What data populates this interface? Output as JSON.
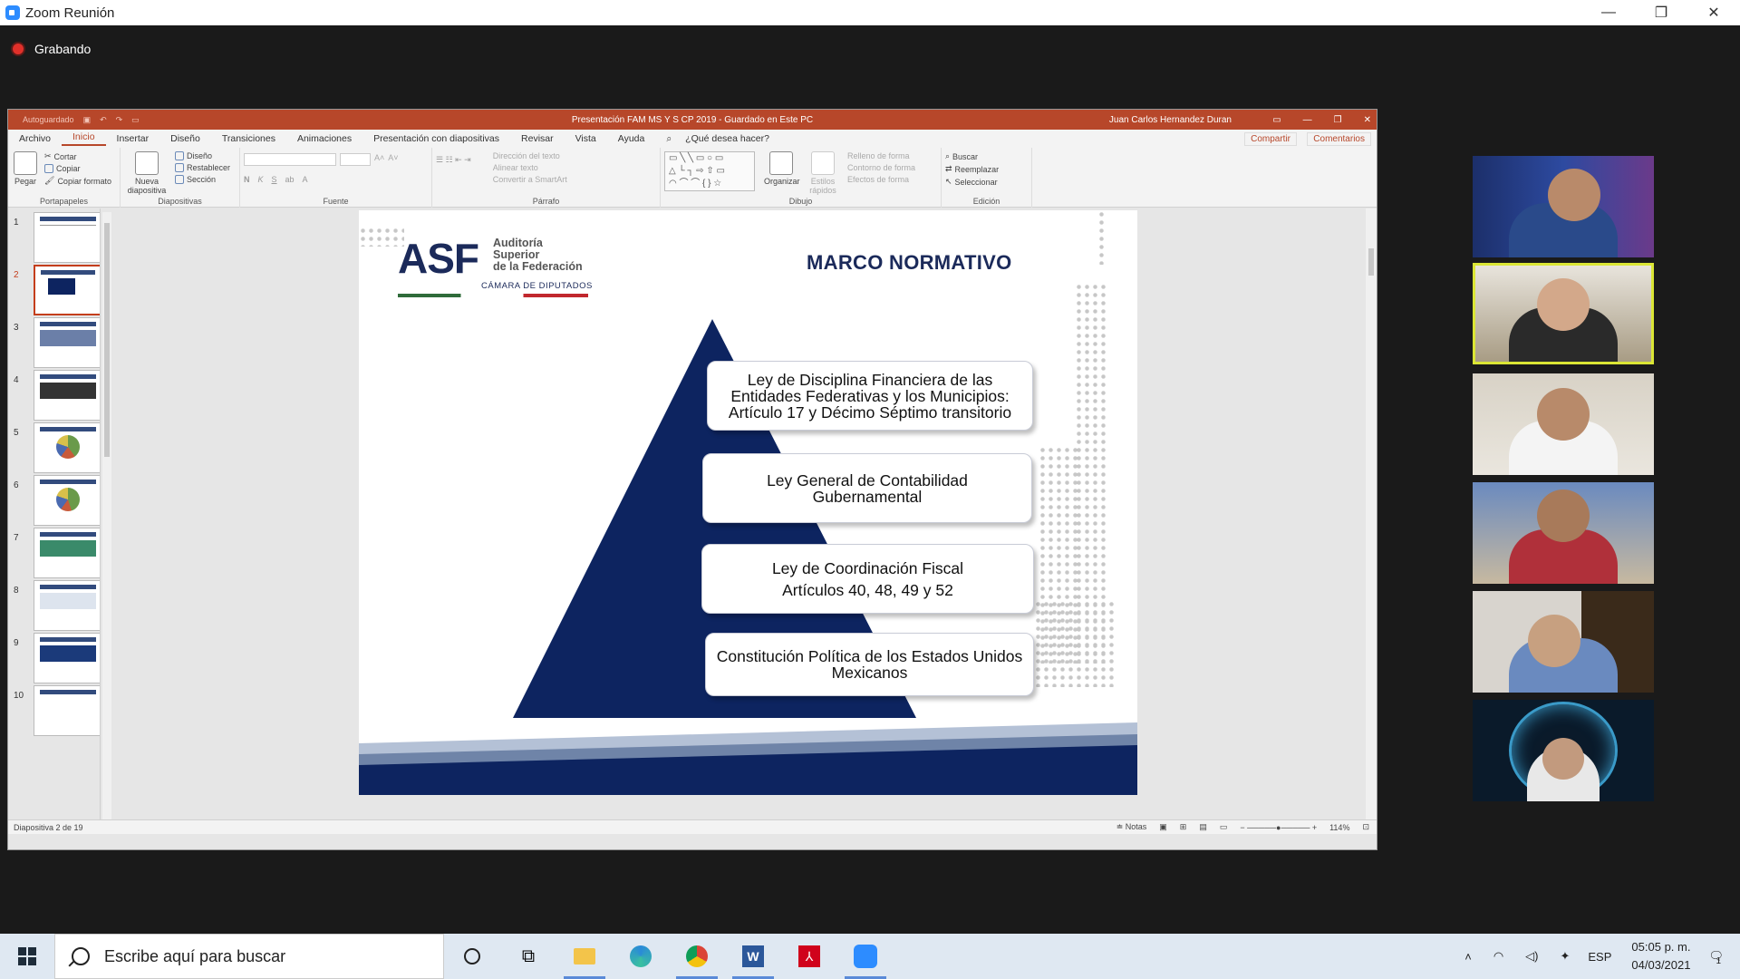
{
  "zoom": {
    "window_title": "Zoom Reunión",
    "recording_label": "Grabando",
    "controls": {
      "minimize": "—",
      "restore": "❐",
      "close": "✕"
    }
  },
  "powerpoint": {
    "title": "Presentación FAM MS Y S CP 2019 - Guardado en Este PC",
    "autosave": "Autoguardado",
    "user": "Juan Carlos Hernandez Duran",
    "tabs": [
      "Archivo",
      "Inicio",
      "Insertar",
      "Diseño",
      "Transiciones",
      "Animaciones",
      "Presentación con diapositivas",
      "Revisar",
      "Vista",
      "Ayuda"
    ],
    "active_tab": "Inicio",
    "tell_me": "¿Qué desea hacer?",
    "share": "Compartir",
    "comments": "Comentarios",
    "ribbon": {
      "portapapeles": {
        "label": "Portapapeles",
        "paste": "Pegar",
        "cut": "Cortar",
        "copy": "Copiar",
        "format": "Copiar formato"
      },
      "diapositivas": {
        "label": "Diapositivas",
        "new": "Nueva diapositiva",
        "layout": "Diseño",
        "reset": "Restablecer",
        "section": "Sección"
      },
      "fuente": {
        "label": "Fuente"
      },
      "parrafo": {
        "label": "Párrafo",
        "dir": "Dirección del texto",
        "align": "Alinear texto",
        "smartart": "Convertir a SmartArt"
      },
      "dibujo": {
        "label": "Dibujo",
        "arrange": "Organizar",
        "styles": "Estilos rápidos",
        "fill": "Relleno de forma",
        "outline": "Contorno de forma",
        "effects": "Efectos de forma"
      },
      "edicion": {
        "label": "Edición",
        "find": "Buscar",
        "replace": "Reemplazar",
        "select": "Seleccionar"
      }
    },
    "status": {
      "slide": "Diapositiva 2 de 19",
      "notes": "Notas",
      "zoom": "114%"
    },
    "thumbnails": [
      1,
      2,
      3,
      4,
      5,
      6,
      7,
      8,
      9,
      10
    ],
    "selected_slide": 2
  },
  "slide": {
    "logo_text": "ASF",
    "logo_sub1": "Auditoría",
    "logo_sub2": "Superior",
    "logo_sub3": "de la Federación",
    "logo_camara": "CÁMARA DE DIPUTADOS",
    "title": "MARCO NORMATIVO",
    "boxes": [
      {
        "line1": "Ley de Disciplina Financiera de las",
        "line2": "Entidades Federativas y los Municipios:",
        "line3": "Artículo 17 y Décimo Séptimo transitorio"
      },
      {
        "line1": "Ley General de Contabilidad",
        "line2": "Gubernamental"
      },
      {
        "line1": "Ley de Coordinación Fiscal",
        "line2": "Artículos 40, 48, 49 y 52"
      },
      {
        "line1": "Constitución Política de los Estados Unidos",
        "line2": "Mexicanos"
      }
    ],
    "colors": {
      "navy": "#0d2460",
      "accent": "#1b2a5a"
    }
  },
  "taskbar": {
    "search_placeholder": "Escribe aquí para buscar",
    "language": "ESP",
    "time": "05:05 p. m.",
    "date": "04/03/2021",
    "notification_count": "1"
  }
}
